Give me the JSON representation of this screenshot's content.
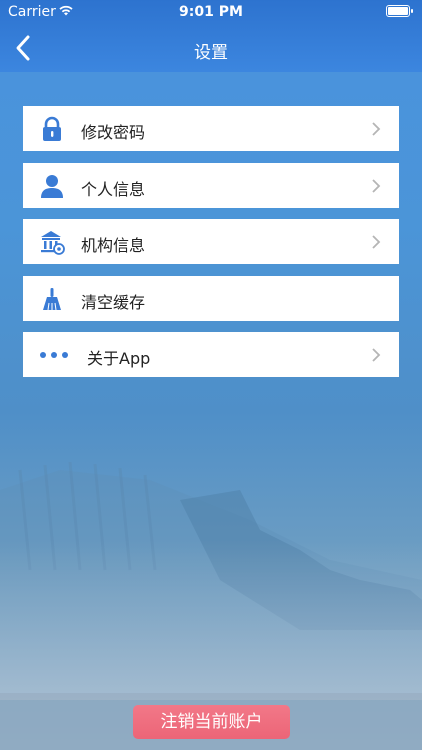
{
  "status_bar": {
    "carrier": "Carrier",
    "time": "9:01 PM"
  },
  "nav": {
    "title": "设置",
    "back_icon": "chevron-left-icon"
  },
  "menu": [
    {
      "label": "修改密码",
      "icon": "lock-icon",
      "has_chevron": true
    },
    {
      "label": "个人信息",
      "icon": "person-icon",
      "has_chevron": true
    },
    {
      "label": "机构信息",
      "icon": "bank-icon",
      "has_chevron": true
    },
    {
      "label": "清空缓存",
      "icon": "broom-icon",
      "has_chevron": false
    },
    {
      "label": "关于App",
      "icon": "more-dots-icon",
      "has_chevron": true
    }
  ],
  "logout_label": "注销当前账户",
  "colors": {
    "nav": "#2d73cf",
    "icon": "#3a7bd5",
    "logout": "#ec6577"
  }
}
